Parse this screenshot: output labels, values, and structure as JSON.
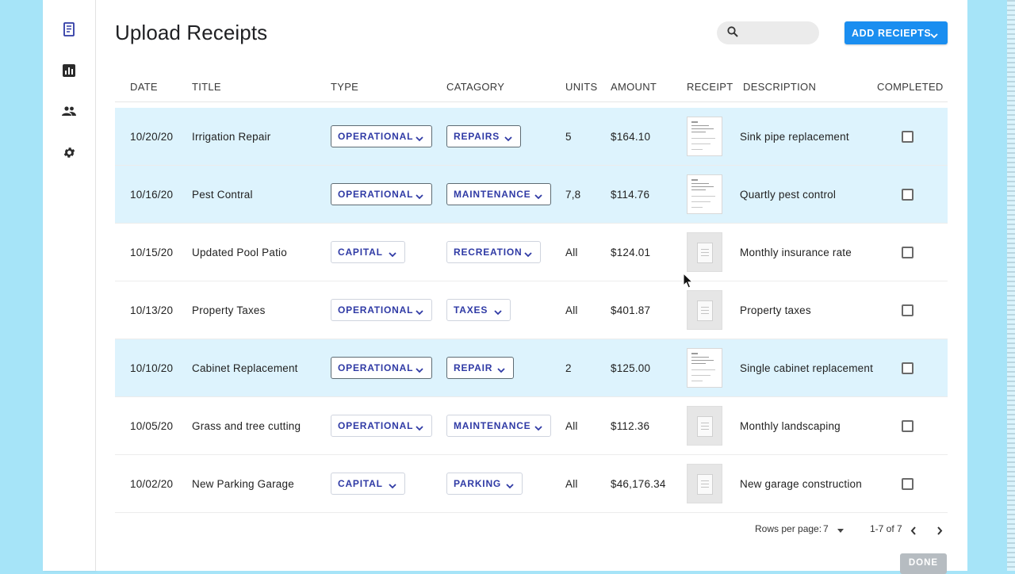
{
  "page": {
    "title": "Upload Receipts"
  },
  "nav": {
    "items": [
      {
        "name": "receipts",
        "icon": "receipt-icon",
        "active": true
      },
      {
        "name": "reports",
        "icon": "bar-chart-icon",
        "active": false
      },
      {
        "name": "people",
        "icon": "people-icon",
        "active": false
      },
      {
        "name": "settings",
        "icon": "gear-icon",
        "active": false
      }
    ]
  },
  "search": {
    "value": "",
    "placeholder": "",
    "icon": "search-icon"
  },
  "toolbar": {
    "add_label": "ADD RECIEPTS",
    "add_color": "#1a8ef0"
  },
  "table": {
    "columns": {
      "date": "DATE",
      "title": "TITLE",
      "type": "TYPE",
      "category": "CATAGORY",
      "units": "UNITS",
      "amount": "AMOUNT",
      "receipt": "RECEIPT",
      "description": "DESCRIPTION",
      "completed": "COMPLETED"
    },
    "highlight_color": "#ddf3fd",
    "chip_text_color": "#2f3aa5",
    "rows": [
      {
        "date": "10/20/20",
        "title": "Irrigation Repair",
        "type": "OPERATIONAL",
        "category": "REPAIRS",
        "units": "5",
        "amount": "$164.10",
        "receipt": "document",
        "description": "Sink pipe replacement",
        "completed": false,
        "highlighted": true
      },
      {
        "date": "10/16/20",
        "title": "Pest Contral",
        "type": "OPERATIONAL",
        "category": "MAINTENANCE",
        "units": "7,8",
        "amount": "$114.76",
        "receipt": "document",
        "description": "Quartly pest control",
        "completed": false,
        "highlighted": true
      },
      {
        "date": "10/15/20",
        "title": "Updated Pool Patio",
        "type": "CAPITAL",
        "category": "RECREATION",
        "units": "All",
        "amount": "$124.01",
        "receipt": "placeholder",
        "description": "Monthly insurance rate",
        "completed": false,
        "highlighted": false
      },
      {
        "date": "10/13/20",
        "title": "Property Taxes",
        "type": "OPERATIONAL",
        "category": "TAXES",
        "units": "All",
        "amount": "$401.87",
        "receipt": "placeholder",
        "description": "Property taxes",
        "completed": false,
        "highlighted": false
      },
      {
        "date": "10/10/20",
        "title": "Cabinet Replacement",
        "type": "OPERATIONAL",
        "category": "REPAIR",
        "units": "2",
        "amount": "$125.00",
        "receipt": "document",
        "description": "Single cabinet replacement",
        "completed": false,
        "highlighted": true
      },
      {
        "date": "10/05/20",
        "title": "Grass and tree cutting",
        "type": "OPERATIONAL",
        "category": "MAINTENANCE",
        "units": "All",
        "amount": "$112.36",
        "receipt": "placeholder",
        "description": "Monthly landscaping",
        "completed": false,
        "highlighted": false
      },
      {
        "date": "10/02/20",
        "title": "New Parking Garage",
        "type": "CAPITAL",
        "category": "PARKING",
        "units": "All",
        "amount": "$46,176.34",
        "receipt": "placeholder",
        "description": "New garage construction",
        "completed": false,
        "highlighted": false
      }
    ]
  },
  "pagination": {
    "rows_per_page_label": "Rows per page:",
    "rows_per_page_value": "7",
    "range_label": "1-7 of 7"
  },
  "footer": {
    "done_label": "DONE",
    "done_color": "#b6bcc1"
  }
}
